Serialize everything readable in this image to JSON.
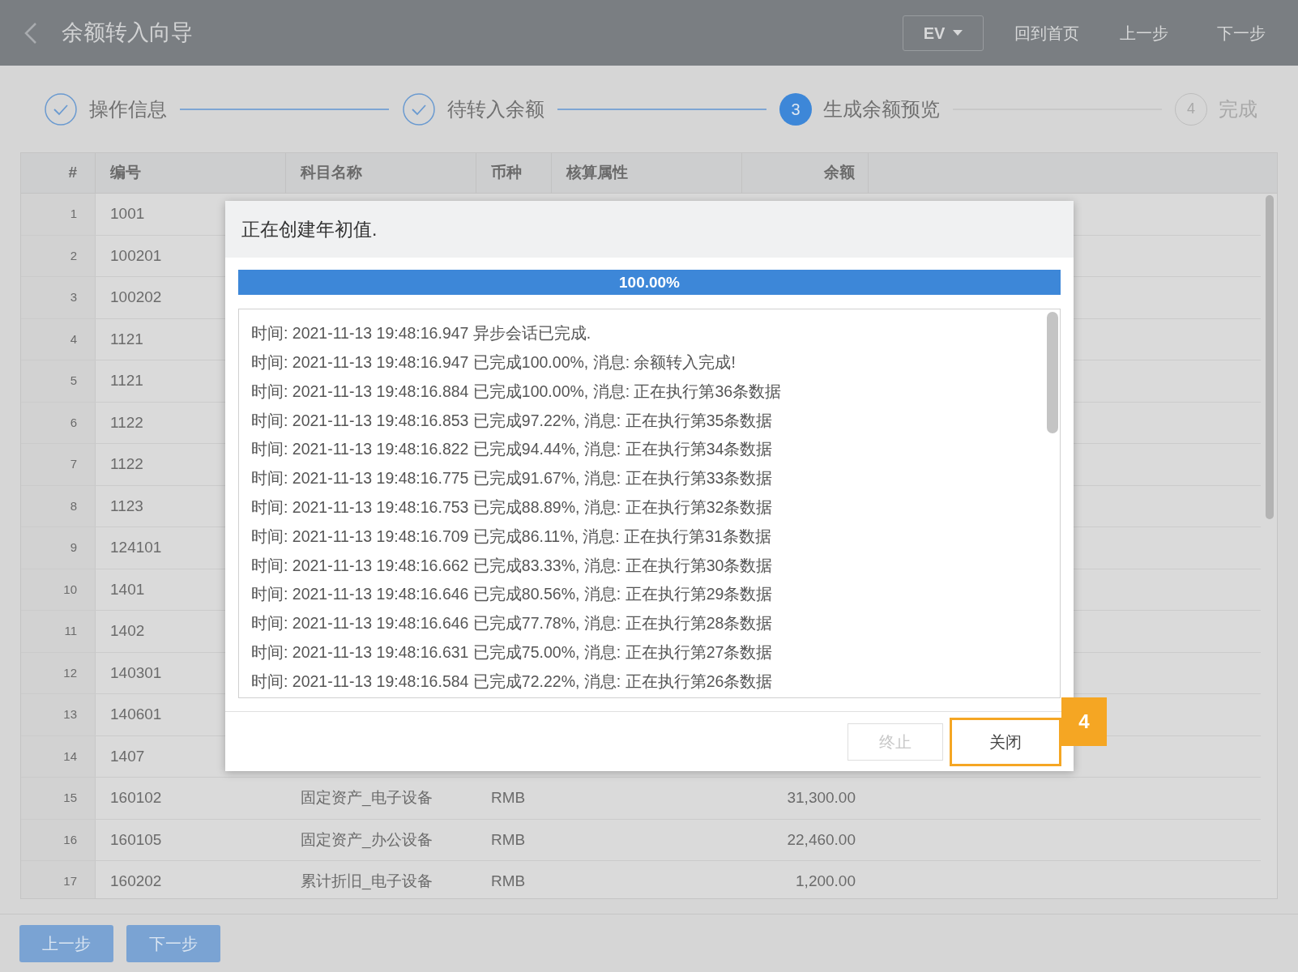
{
  "header": {
    "title": "余额转入向导",
    "dropdown": "EV",
    "buttons": [
      "回到首页",
      "上一步",
      "下一步"
    ]
  },
  "steps": [
    {
      "label": "操作信息",
      "kind": "done"
    },
    {
      "label": "待转入余额",
      "kind": "done"
    },
    {
      "label": "生成余额预览",
      "kind": "active",
      "number": "3"
    },
    {
      "label": "完成",
      "kind": "pending",
      "number": "4"
    }
  ],
  "table": {
    "columns": [
      "#",
      "编号",
      "科目名称",
      "币种",
      "核算属性",
      "余额"
    ],
    "rows": [
      {
        "index": "1",
        "code": "1001"
      },
      {
        "index": "2",
        "code": "100201"
      },
      {
        "index": "3",
        "code": "100202"
      },
      {
        "index": "4",
        "code": "1121"
      },
      {
        "index": "5",
        "code": "1121"
      },
      {
        "index": "6",
        "code": "1122"
      },
      {
        "index": "7",
        "code": "1122"
      },
      {
        "index": "8",
        "code": "1123"
      },
      {
        "index": "9",
        "code": "124101"
      },
      {
        "index": "10",
        "code": "1401"
      },
      {
        "index": "11",
        "code": "1402"
      },
      {
        "index": "12",
        "code": "140301"
      },
      {
        "index": "13",
        "code": "140601"
      },
      {
        "index": "14",
        "code": "1407"
      },
      {
        "index": "15",
        "code": "160102",
        "name": "固定资产_电子设备",
        "currency": "RMB",
        "balance": "31,300.00"
      },
      {
        "index": "16",
        "code": "160105",
        "name": "固定资产_办公设备",
        "currency": "RMB",
        "balance": "22,460.00"
      },
      {
        "index": "17",
        "code": "160202",
        "name": "累计折旧_电子设备",
        "currency": "RMB",
        "balance": "1,200.00"
      }
    ]
  },
  "dialog": {
    "title": "正在创建年初值.",
    "progress": {
      "level": 1.0,
      "label": "100.00%"
    },
    "log": [
      "时间: 2021-11-13 19:48:16.947 异步会话已完成.",
      "时间: 2021-11-13 19:48:16.947 已完成100.00%, 消息: 余额转入完成!",
      "时间: 2021-11-13 19:48:16.884 已完成100.00%, 消息: 正在执行第36条数据",
      "时间: 2021-11-13 19:48:16.853 已完成97.22%, 消息: 正在执行第35条数据",
      "时间: 2021-11-13 19:48:16.822 已完成94.44%, 消息: 正在执行第34条数据",
      "时间: 2021-11-13 19:48:16.775 已完成91.67%, 消息: 正在执行第33条数据",
      "时间: 2021-11-13 19:48:16.753 已完成88.89%, 消息: 正在执行第32条数据",
      "时间: 2021-11-13 19:48:16.709 已完成86.11%, 消息: 正在执行第31条数据",
      "时间: 2021-11-13 19:48:16.662 已完成83.33%, 消息: 正在执行第30条数据",
      "时间: 2021-11-13 19:48:16.646 已完成80.56%, 消息: 正在执行第29条数据",
      "时间: 2021-11-13 19:48:16.646 已完成77.78%, 消息: 正在执行第28条数据",
      "时间: 2021-11-13 19:48:16.631 已完成75.00%, 消息: 正在执行第27条数据",
      "时间: 2021-11-13 19:48:16.584 已完成72.22%, 消息: 正在执行第26条数据"
    ],
    "buttons": [
      {
        "label": "终止",
        "disabled": true,
        "highlighted": false
      },
      {
        "label": "关闭",
        "disabled": false,
        "highlighted": true,
        "callout": "4"
      }
    ]
  },
  "footer": {
    "buttons": [
      "上一步",
      "下一步"
    ]
  }
}
